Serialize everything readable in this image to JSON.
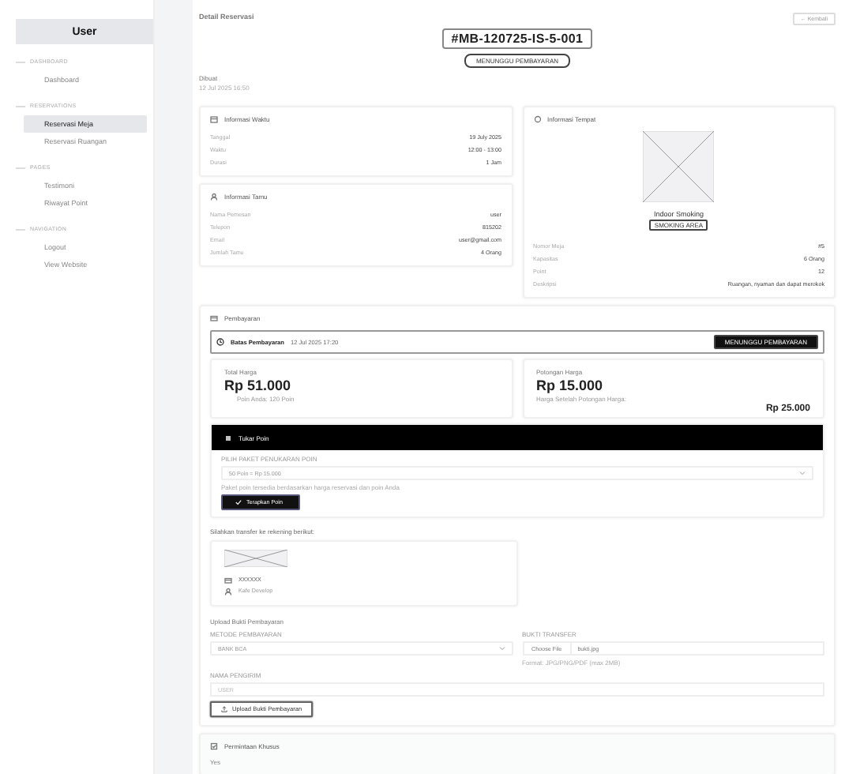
{
  "sidebar": {
    "title": "User",
    "sections": [
      {
        "heading": "DASHBOARD",
        "items": [
          {
            "label": "Dashboard",
            "selected": false
          }
        ]
      },
      {
        "heading": "RESERVATIONS",
        "items": [
          {
            "label": "Reservasi Meja",
            "selected": true
          },
          {
            "label": "Reservasi Ruangan",
            "selected": false
          }
        ]
      },
      {
        "heading": "PAGES",
        "items": [
          {
            "label": "Testimoni",
            "selected": false
          },
          {
            "label": "Riwayat Point",
            "selected": false
          }
        ]
      },
      {
        "heading": "NAVIGATION",
        "items": [
          {
            "label": "Logout",
            "selected": false
          },
          {
            "label": "View Website",
            "selected": false
          }
        ]
      }
    ]
  },
  "header": {
    "title": "Detail Reservasi",
    "back_button": "← Kembali",
    "code": "#MB-120725-IS-5-001",
    "status": "MENUNGGU PEMBAYARAN",
    "created_label": "Dibuat",
    "created_value": "12 Jul 2025 16:50"
  },
  "time_card": {
    "title": "Informasi Waktu",
    "rows": [
      {
        "label": "Tanggal",
        "value": "19 July 2025"
      },
      {
        "label": "Waktu",
        "value": "12:00 - 13:00"
      },
      {
        "label": "Durasi",
        "value": "1 Jam"
      }
    ]
  },
  "guest_card": {
    "title": "Informasi Tamu",
    "rows": [
      {
        "label": "Nama Pemesan",
        "value": "user"
      },
      {
        "label": "Telepon",
        "value": "815202"
      },
      {
        "label": "Email",
        "value": "user@gmail.com"
      },
      {
        "label": "Jumlah Tamu",
        "value": "4 Orang"
      }
    ]
  },
  "place_card": {
    "title": "Informasi Tempat",
    "name": "Indoor Smoking",
    "tag": "SMOKING AREA",
    "rows": [
      {
        "label": "Nomor Meja",
        "value": "#5"
      },
      {
        "label": "Kapasitas",
        "value": "6 Orang"
      },
      {
        "label": "Point",
        "value": "12"
      },
      {
        "label": "Deskripsi",
        "value": "Ruangan, nyaman dan dapat merokok"
      }
    ]
  },
  "payment": {
    "title": "Pembayaran",
    "deadline_label": "Batas Pembayaran",
    "deadline_value": "12 Jul 2025 17:20",
    "deadline_status": "MENUNGGU PEMBAYARAN",
    "total": {
      "label": "Total Harga",
      "amount": "Rp 51.000",
      "note": "Poin Anda: 120 Poin"
    },
    "discount": {
      "label": "Potongan Harga",
      "amount": "Rp 15.000",
      "note": "Harga Setelah Potongan Harga:",
      "final": "Rp 25.000"
    },
    "points": {
      "title": "Tukar Poin",
      "select_label": "PILIH PAKET PENUKARAN POIN",
      "select_value": "50 Poin = Rp 15.000",
      "hint": "Paket poin tersedia berdasarkan harga reservasi dan poin Anda",
      "apply_button": "Terapkan Poin"
    },
    "transfer_note": "Silahkan transfer ke rekening berikut:",
    "account_number": "XXXXXX",
    "account_name": "Kafe Develop",
    "upload": {
      "title": "Upload Bukti Pembayaran",
      "method_label": "METODE PEMBAYARAN",
      "method_value": "BANK BCA",
      "file_label": "BUKTI TRANSFER",
      "file_button": "Choose File",
      "file_name": "bukti.jpg",
      "file_hint": "Format: JPG/PNG/PDF (max 2MB)",
      "sender_label": "NAMA PENGIRIM",
      "sender_placeholder": "USER",
      "submit_button": "Upload Bukti Pembayaran"
    }
  },
  "special_request": {
    "title": "Permintaan Khusus",
    "text": "Yes"
  }
}
